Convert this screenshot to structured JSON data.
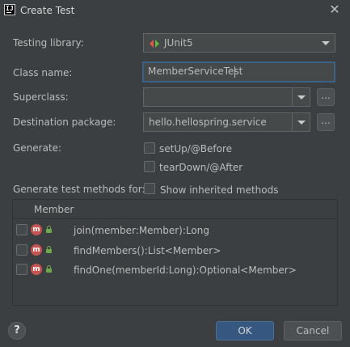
{
  "window": {
    "title": "Create Test",
    "app_icon_text": "IJ"
  },
  "form": {
    "testing_library": {
      "label": "Testing library:",
      "value": "JUnit5"
    },
    "class_name": {
      "label": "Class name:",
      "value": "MemberServiceTest"
    },
    "superclass": {
      "label": "Superclass:",
      "value": "",
      "browse_label": "..."
    },
    "destination_package": {
      "label": "Destination package:",
      "value": "hello.hellospring.service",
      "browse_label": "..."
    },
    "generate": {
      "label": "Generate:",
      "options": [
        {
          "label": "setUp/@Before",
          "checked": false
        },
        {
          "label": "tearDown/@After",
          "checked": false
        }
      ]
    },
    "generate_methods": {
      "label": "Generate test methods for:",
      "show_inherited": {
        "label": "Show inherited methods",
        "checked": false
      }
    }
  },
  "members": {
    "header": "Member",
    "icon_letter": "m",
    "items": [
      {
        "signature": "join(member:Member):Long",
        "checked": false
      },
      {
        "signature": "findMembers():List<Member>",
        "checked": false
      },
      {
        "signature": "findOne(memberId:Long):Optional<Member>",
        "checked": false
      }
    ]
  },
  "buttons": {
    "help": "?",
    "ok": "OK",
    "cancel": "Cancel"
  },
  "colors": {
    "background": "#3c3f41",
    "field_bg": "#45494a",
    "focus_border": "#3d6185",
    "primary_button": "#365880",
    "method_icon": "#c75450",
    "lock_icon": "#6fa84a",
    "junit_red": "#e05a47",
    "junit_green": "#62b543"
  }
}
